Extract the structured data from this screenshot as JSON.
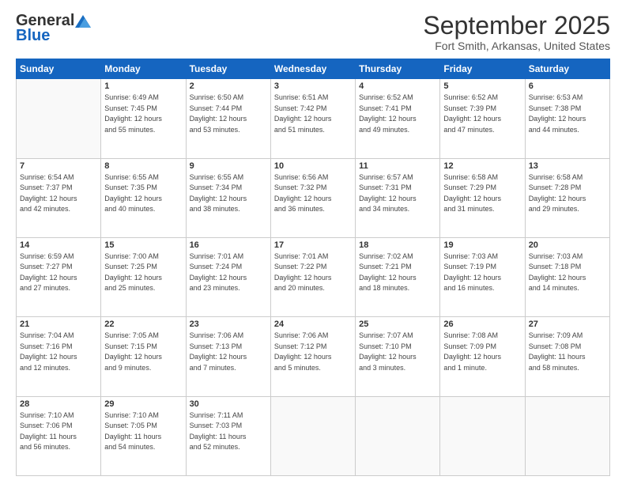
{
  "header": {
    "logo_general": "General",
    "logo_blue": "Blue",
    "month_title": "September 2025",
    "location": "Fort Smith, Arkansas, United States"
  },
  "weekdays": [
    "Sunday",
    "Monday",
    "Tuesday",
    "Wednesday",
    "Thursday",
    "Friday",
    "Saturday"
  ],
  "weeks": [
    [
      {
        "day": "",
        "info": ""
      },
      {
        "day": "1",
        "info": "Sunrise: 6:49 AM\nSunset: 7:45 PM\nDaylight: 12 hours\nand 55 minutes."
      },
      {
        "day": "2",
        "info": "Sunrise: 6:50 AM\nSunset: 7:44 PM\nDaylight: 12 hours\nand 53 minutes."
      },
      {
        "day": "3",
        "info": "Sunrise: 6:51 AM\nSunset: 7:42 PM\nDaylight: 12 hours\nand 51 minutes."
      },
      {
        "day": "4",
        "info": "Sunrise: 6:52 AM\nSunset: 7:41 PM\nDaylight: 12 hours\nand 49 minutes."
      },
      {
        "day": "5",
        "info": "Sunrise: 6:52 AM\nSunset: 7:39 PM\nDaylight: 12 hours\nand 47 minutes."
      },
      {
        "day": "6",
        "info": "Sunrise: 6:53 AM\nSunset: 7:38 PM\nDaylight: 12 hours\nand 44 minutes."
      }
    ],
    [
      {
        "day": "7",
        "info": "Sunrise: 6:54 AM\nSunset: 7:37 PM\nDaylight: 12 hours\nand 42 minutes."
      },
      {
        "day": "8",
        "info": "Sunrise: 6:55 AM\nSunset: 7:35 PM\nDaylight: 12 hours\nand 40 minutes."
      },
      {
        "day": "9",
        "info": "Sunrise: 6:55 AM\nSunset: 7:34 PM\nDaylight: 12 hours\nand 38 minutes."
      },
      {
        "day": "10",
        "info": "Sunrise: 6:56 AM\nSunset: 7:32 PM\nDaylight: 12 hours\nand 36 minutes."
      },
      {
        "day": "11",
        "info": "Sunrise: 6:57 AM\nSunset: 7:31 PM\nDaylight: 12 hours\nand 34 minutes."
      },
      {
        "day": "12",
        "info": "Sunrise: 6:58 AM\nSunset: 7:29 PM\nDaylight: 12 hours\nand 31 minutes."
      },
      {
        "day": "13",
        "info": "Sunrise: 6:58 AM\nSunset: 7:28 PM\nDaylight: 12 hours\nand 29 minutes."
      }
    ],
    [
      {
        "day": "14",
        "info": "Sunrise: 6:59 AM\nSunset: 7:27 PM\nDaylight: 12 hours\nand 27 minutes."
      },
      {
        "day": "15",
        "info": "Sunrise: 7:00 AM\nSunset: 7:25 PM\nDaylight: 12 hours\nand 25 minutes."
      },
      {
        "day": "16",
        "info": "Sunrise: 7:01 AM\nSunset: 7:24 PM\nDaylight: 12 hours\nand 23 minutes."
      },
      {
        "day": "17",
        "info": "Sunrise: 7:01 AM\nSunset: 7:22 PM\nDaylight: 12 hours\nand 20 minutes."
      },
      {
        "day": "18",
        "info": "Sunrise: 7:02 AM\nSunset: 7:21 PM\nDaylight: 12 hours\nand 18 minutes."
      },
      {
        "day": "19",
        "info": "Sunrise: 7:03 AM\nSunset: 7:19 PM\nDaylight: 12 hours\nand 16 minutes."
      },
      {
        "day": "20",
        "info": "Sunrise: 7:03 AM\nSunset: 7:18 PM\nDaylight: 12 hours\nand 14 minutes."
      }
    ],
    [
      {
        "day": "21",
        "info": "Sunrise: 7:04 AM\nSunset: 7:16 PM\nDaylight: 12 hours\nand 12 minutes."
      },
      {
        "day": "22",
        "info": "Sunrise: 7:05 AM\nSunset: 7:15 PM\nDaylight: 12 hours\nand 9 minutes."
      },
      {
        "day": "23",
        "info": "Sunrise: 7:06 AM\nSunset: 7:13 PM\nDaylight: 12 hours\nand 7 minutes."
      },
      {
        "day": "24",
        "info": "Sunrise: 7:06 AM\nSunset: 7:12 PM\nDaylight: 12 hours\nand 5 minutes."
      },
      {
        "day": "25",
        "info": "Sunrise: 7:07 AM\nSunset: 7:10 PM\nDaylight: 12 hours\nand 3 minutes."
      },
      {
        "day": "26",
        "info": "Sunrise: 7:08 AM\nSunset: 7:09 PM\nDaylight: 12 hours\nand 1 minute."
      },
      {
        "day": "27",
        "info": "Sunrise: 7:09 AM\nSunset: 7:08 PM\nDaylight: 11 hours\nand 58 minutes."
      }
    ],
    [
      {
        "day": "28",
        "info": "Sunrise: 7:10 AM\nSunset: 7:06 PM\nDaylight: 11 hours\nand 56 minutes."
      },
      {
        "day": "29",
        "info": "Sunrise: 7:10 AM\nSunset: 7:05 PM\nDaylight: 11 hours\nand 54 minutes."
      },
      {
        "day": "30",
        "info": "Sunrise: 7:11 AM\nSunset: 7:03 PM\nDaylight: 11 hours\nand 52 minutes."
      },
      {
        "day": "",
        "info": ""
      },
      {
        "day": "",
        "info": ""
      },
      {
        "day": "",
        "info": ""
      },
      {
        "day": "",
        "info": ""
      }
    ]
  ]
}
